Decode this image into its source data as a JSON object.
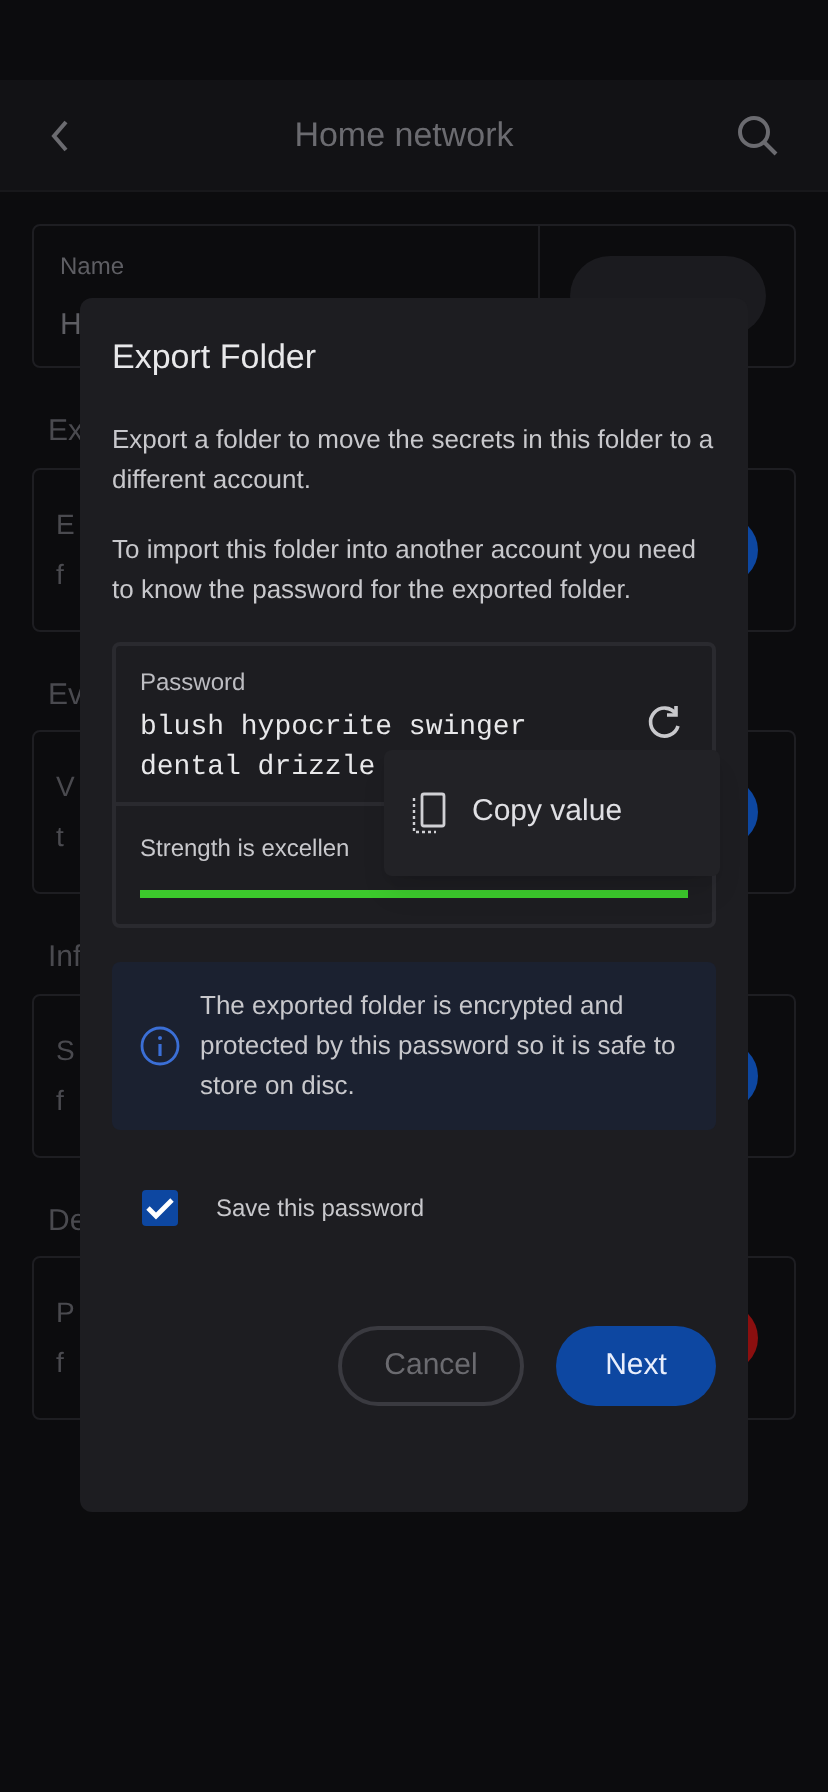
{
  "header": {
    "title": "Home network"
  },
  "name_card": {
    "label": "Name",
    "value": "H"
  },
  "sections": [
    {
      "label": "Ex",
      "lines": [
        "E",
        "f"
      ],
      "color": "#0d47a1"
    },
    {
      "label": "Ev",
      "lines": [
        "V",
        "t"
      ],
      "color": "#0d47a1"
    },
    {
      "label": "Inf",
      "lines": [
        "S",
        "f"
      ],
      "color": "#0d47a1"
    },
    {
      "label": "De",
      "lines": [
        "P",
        "f"
      ],
      "color": "#8b0f0f"
    }
  ],
  "dialog": {
    "title": "Export Folder",
    "paragraphs": [
      "Export a folder to move the secrets in this folder to a different account.",
      "To import this folder into another account you need to know the password for the exported folder."
    ],
    "password": {
      "label": "Password",
      "value": "blush hypocrite swinger dental drizzle",
      "strength": "Strength is excellen",
      "level": 1
    },
    "menu": {
      "items": [
        "Copy value"
      ]
    },
    "info": "The exported folder is encrypted and protected by this password so it is safe to store on disc.",
    "save_checkbox": {
      "label": "Save this password",
      "checked": true
    },
    "buttons": [
      {
        "label": "Cancel",
        "kind": "outline"
      },
      {
        "label": "Next",
        "kind": "primary"
      }
    ]
  }
}
